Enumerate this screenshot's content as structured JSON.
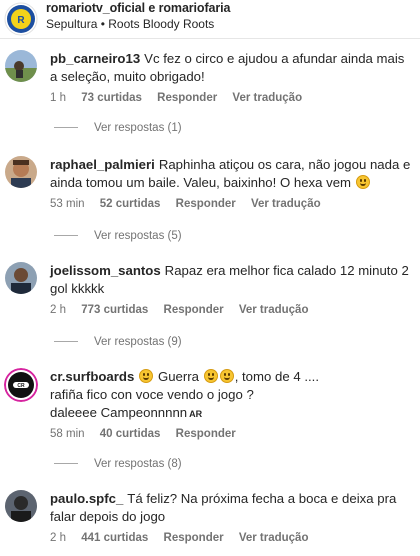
{
  "post": {
    "accounts": "romariotv_oficial e romariofaria",
    "song": "Sepultura • Roots Bloody Roots"
  },
  "comments": [
    {
      "username": "pb_carneiro13",
      "text": "Vc fez o circo e ajudou a afundar ainda mais a seleção, muito obrigado!",
      "time": "1 h",
      "likes": "73 curtidas",
      "reply_label": "Responder",
      "translate_label": "Ver tradução",
      "view_replies": "Ver respostas (1)"
    },
    {
      "username": "raphael_palmieri",
      "text": "Raphinha atiçou os cara, não jogou nada e ainda tomou um baile. Valeu, baixinho! O hexa vem",
      "time": "53 min",
      "likes": "52 curtidas",
      "reply_label": "Responder",
      "translate_label": "Ver tradução",
      "view_replies": "Ver respostas (5)"
    },
    {
      "username": "joelissom_santos",
      "text": "Rapaz era melhor fica calado 12 minuto 2 gol kkkkk",
      "time": "2 h",
      "likes": "773 curtidas",
      "reply_label": "Responder",
      "translate_label": "Ver tradução",
      "view_replies": "Ver respostas (9)"
    },
    {
      "username": "cr.surfboards",
      "text_a": "Guerra",
      "text_b": ", tomo de 4 ....",
      "text_line2": "rafiña fico con voce vendo o jogo ?",
      "text_line3": "daleeee Campeonnnnn",
      "ar_badge": "AR",
      "time": "58 min",
      "likes": "40 curtidas",
      "reply_label": "Responder",
      "view_replies": "Ver respostas (8)"
    },
    {
      "username": "paulo.spfc_",
      "text": "Tá feliz? Na próxima fecha a boca e deixa pra falar depois do jogo",
      "time": "2 h",
      "likes": "441 curtidas",
      "reply_label": "Responder",
      "translate_label": "Ver tradução"
    }
  ],
  "colors": {
    "text": "#262626",
    "secondary": "#737373",
    "story_ring": "#d6249f"
  }
}
